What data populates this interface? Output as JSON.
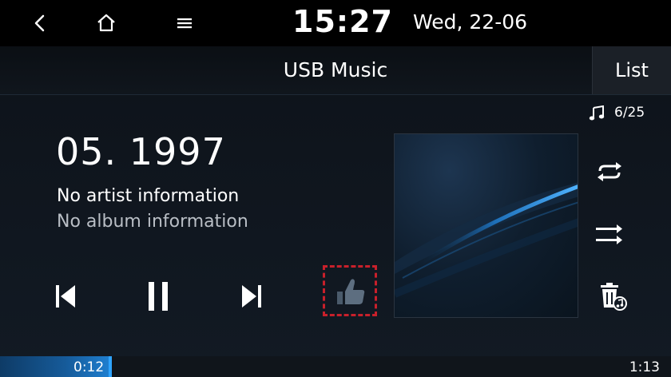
{
  "status_bar": {
    "time": "15:27",
    "date": "Wed, 22-06",
    "back_icon": "chevron-left-icon",
    "home_icon": "home-icon",
    "menu_icon": "menu-icon"
  },
  "header": {
    "title": "USB Music",
    "list_label": "List"
  },
  "track": {
    "counter": "6/25",
    "title": "05. 1997",
    "artist": "No artist information",
    "album": "No album information"
  },
  "playback": {
    "state": "playing",
    "elapsed": "0:12",
    "total": "1:13",
    "progress": 0.164
  },
  "controls": {
    "prev_icon": "skip-previous-icon",
    "pause_icon": "pause-icon",
    "next_icon": "skip-next-icon",
    "like_icon": "thumbs-up-icon",
    "repeat_icon": "repeat-icon",
    "shuffle_icon": "shuffle-icon",
    "delete_icon": "delete-track-icon",
    "like_highlight_color": "#c8202b"
  },
  "colors": {
    "accent": "#2fa4ff",
    "text_secondary": "#b9bec5"
  }
}
